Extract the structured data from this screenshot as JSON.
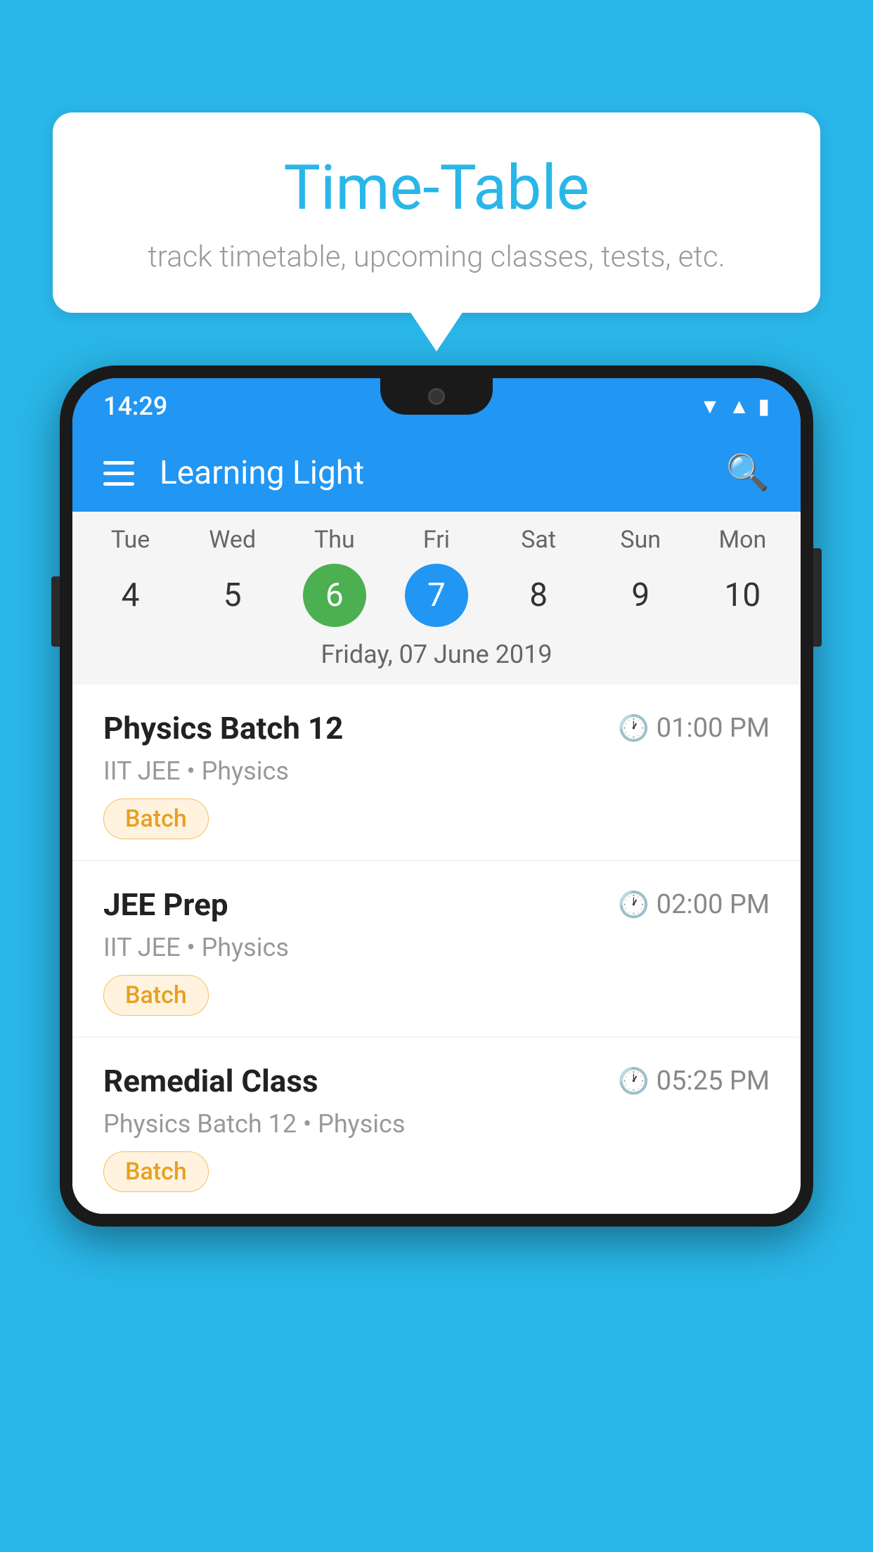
{
  "background_color": "#29b6e8",
  "bubble": {
    "title": "Time-Table",
    "subtitle": "track timetable, upcoming classes, tests, etc."
  },
  "app": {
    "title": "Learning Light",
    "time": "14:29"
  },
  "calendar": {
    "days": [
      {
        "name": "Tue",
        "num": "4",
        "state": "normal"
      },
      {
        "name": "Wed",
        "num": "5",
        "state": "normal"
      },
      {
        "name": "Thu",
        "num": "6",
        "state": "today"
      },
      {
        "name": "Fri",
        "num": "7",
        "state": "selected"
      },
      {
        "name": "Sat",
        "num": "8",
        "state": "normal"
      },
      {
        "name": "Sun",
        "num": "9",
        "state": "normal"
      },
      {
        "name": "Mon",
        "num": "10",
        "state": "normal"
      }
    ],
    "selected_date": "Friday, 07 June 2019"
  },
  "schedule": [
    {
      "title": "Physics Batch 12",
      "time": "01:00 PM",
      "subtitle": "IIT JEE • Physics",
      "badge": "Batch"
    },
    {
      "title": "JEE Prep",
      "time": "02:00 PM",
      "subtitle": "IIT JEE • Physics",
      "badge": "Batch"
    },
    {
      "title": "Remedial Class",
      "time": "05:25 PM",
      "subtitle": "Physics Batch 12 • Physics",
      "badge": "Batch"
    }
  ]
}
